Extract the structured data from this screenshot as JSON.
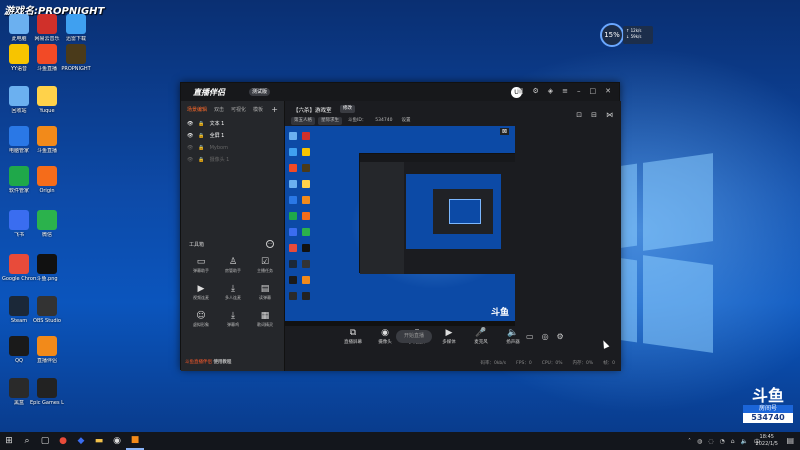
{
  "watermark": "游戏名:PROPNIGHT",
  "desktop_icons": [
    {
      "label": "此电脑",
      "icon": "computer-icon",
      "color": "#6bb0f0"
    },
    {
      "label": "网易云音乐",
      "icon": "music-icon",
      "color": "#d0302a"
    },
    {
      "label": "迅雷下载",
      "icon": "thunder-icon",
      "color": "#3fa0f0"
    },
    {
      "label": "YY语音",
      "icon": "yy-icon",
      "color": "#f7c400"
    },
    {
      "label": "斗鱼直播",
      "icon": "douyu-icon",
      "color": "#f24a26"
    },
    {
      "label": "PROPNIGHT",
      "icon": "game-icon",
      "color": "#4a3a1a"
    },
    {
      "label": "回收站",
      "icon": "recycle-bin-icon",
      "color": "#6bb0f0"
    },
    {
      "label": "Yuque",
      "icon": "yuque-icon",
      "color": "#ffd24a"
    },
    {
      "label": "电脑管家",
      "icon": "shield-icon",
      "color": "#2a78e6"
    },
    {
      "label": "斗鱼直播",
      "icon": "live-icon",
      "color": "#f28a1a"
    },
    {
      "label": "软件管家",
      "icon": "apps-icon",
      "color": "#1fa84a"
    },
    {
      "label": "Origin",
      "icon": "origin-icon",
      "color": "#f56c1a"
    },
    {
      "label": "飞书",
      "icon": "feishu-icon",
      "color": "#3a6df0"
    },
    {
      "label": "微信",
      "icon": "wechat-icon",
      "color": "#2bb24c"
    },
    {
      "label": "Google Chrome",
      "icon": "chrome-icon",
      "color": "#e84b3a"
    },
    {
      "label": "斗鱼.png",
      "icon": "image-icon",
      "color": "#111111"
    },
    {
      "label": "Steam",
      "icon": "steam-icon",
      "color": "#1b2838"
    },
    {
      "label": "OBS Studio",
      "icon": "obs-icon",
      "color": "#333333"
    },
    {
      "label": "QQ",
      "icon": "qq-icon",
      "color": "#1a1a1a"
    },
    {
      "label": "直播伴侣",
      "icon": "companion-icon",
      "color": "#f28a1a"
    },
    {
      "label": "黑盒",
      "icon": "heihe-icon",
      "color": "#2a2a2a"
    },
    {
      "label": "Epic Games Launcher",
      "icon": "epic-icon",
      "color": "#222222"
    }
  ],
  "gauge": {
    "value": "15%",
    "up": "↑ 12k/s",
    "down": "↓ 59k/s"
  },
  "app": {
    "brand": "直播伴侣",
    "badge": "测试版",
    "avatar": "U",
    "scene_tabs": [
      "场景编辑",
      "双击",
      "可视化",
      "模板"
    ],
    "sources": [
      {
        "label": "文本 1",
        "dim": false
      },
      {
        "label": "全屏 1",
        "dim": false
      },
      {
        "label": "Mybom",
        "dim": true
      },
      {
        "label": "摄像头 1",
        "dim": true
      }
    ],
    "tools_title": "工具箱",
    "tools": [
      {
        "label": "弹幕助手",
        "icon": "chat-icon"
      },
      {
        "label": "房管助手",
        "icon": "user-icon"
      },
      {
        "label": "主播任务",
        "icon": "task-icon"
      },
      {
        "label": "视频连麦",
        "icon": "video-icon"
      },
      {
        "label": "多人连麦",
        "icon": "download-icon"
      },
      {
        "label": "读弹幕",
        "icon": "read-icon"
      },
      {
        "label": "虚拟形象",
        "icon": "avatar-icon"
      },
      {
        "label": "弹幕鸡",
        "icon": "download-icon"
      },
      {
        "label": "歌词精灵",
        "icon": "lyric-icon"
      }
    ],
    "notice_prefix": "斗鱼直播伴侣",
    "notice_text": "使用教程",
    "room_title": "【六杀】游戏室",
    "room_button": "修改",
    "room_tags": [
      "第五人格",
      "星际求生",
      "斗鱼ID：",
      "534740",
      "设置"
    ],
    "controls": [
      {
        "label": "直播屏幕",
        "icon": "screen-icon"
      },
      {
        "label": "摄像头",
        "icon": "camera-icon"
      },
      {
        "label": "手机投屏",
        "icon": "phone-icon"
      },
      {
        "label": "多媒体",
        "icon": "media-icon"
      },
      {
        "label": "麦克风",
        "icon": "mic-icon"
      },
      {
        "label": "扬声器",
        "icon": "speaker-icon"
      }
    ],
    "start_button": "开始直播",
    "status": [
      "码率：0kb/s",
      "FPS：0",
      "CPU：0%",
      "内存：0%",
      "帧：0"
    ]
  },
  "douyu": {
    "logo": "斗鱼",
    "sub": "房间号",
    "room": "534740"
  },
  "clock": {
    "time": "18:45",
    "date": "2022/1/5"
  }
}
